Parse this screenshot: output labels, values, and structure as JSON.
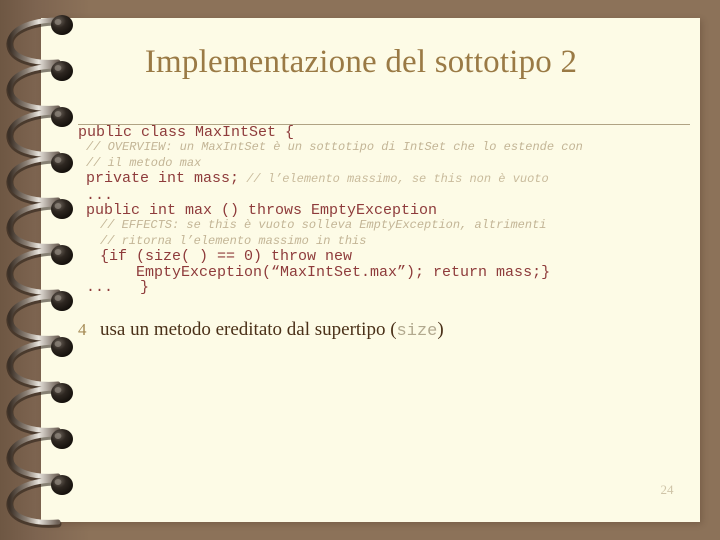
{
  "slide": {
    "title": "Implementazione del sottotipo 2",
    "page_number": "24",
    "colors": {
      "background": "#8c7259",
      "page": "#fdfbe6",
      "title": "#9a7a45",
      "code": "#8e3b3b",
      "comment": "#c3b596",
      "body_text": "#4a3018",
      "bullet_mark": "#a58a55"
    }
  },
  "code_block": {
    "lines": [
      {
        "id": "line-1",
        "kind": "code",
        "indent": 0,
        "text": "public class MaxIntSet {"
      },
      {
        "id": "line-2",
        "kind": "comment",
        "indent": 1,
        "text": "// OVERVIEW: un MaxIntSet è un sottotipo di IntSet che lo estende con"
      },
      {
        "id": "line-3",
        "kind": "comment",
        "indent": 1,
        "text": "// il metodo max"
      },
      {
        "id": "line-4",
        "kind": "code",
        "indent": 1,
        "text": "private int mass;",
        "trailing_comment": " // l’elemento massimo, se this non è vuoto"
      },
      {
        "id": "line-5",
        "kind": "code",
        "indent": 1,
        "text": "..."
      },
      {
        "id": "line-6",
        "kind": "code",
        "indent": 1,
        "text": "public int max () throws EmptyException"
      },
      {
        "id": "line-7",
        "kind": "comment",
        "indent": 2,
        "text": "// EFFECTS: se this è vuoto solleva EmptyException, altrimenti"
      },
      {
        "id": "line-8",
        "kind": "comment",
        "indent": 2,
        "text": "// ritorna l’elemento massimo in this"
      },
      {
        "id": "line-9",
        "kind": "code",
        "indent": 2,
        "text": "{if (size( ) == 0) throw new"
      },
      {
        "id": "line-10",
        "kind": "code",
        "indent": 3,
        "text": "EmptyException(“MaxIntSet.max”); return mass;}"
      },
      {
        "id": "line-11",
        "kind": "code",
        "indent": 1,
        "text": "...   }"
      }
    ]
  },
  "bullet": {
    "marker": "4",
    "text_before": "usa un metodo ereditato dal supertipo (",
    "mono_text": "size",
    "text_after": ")"
  }
}
